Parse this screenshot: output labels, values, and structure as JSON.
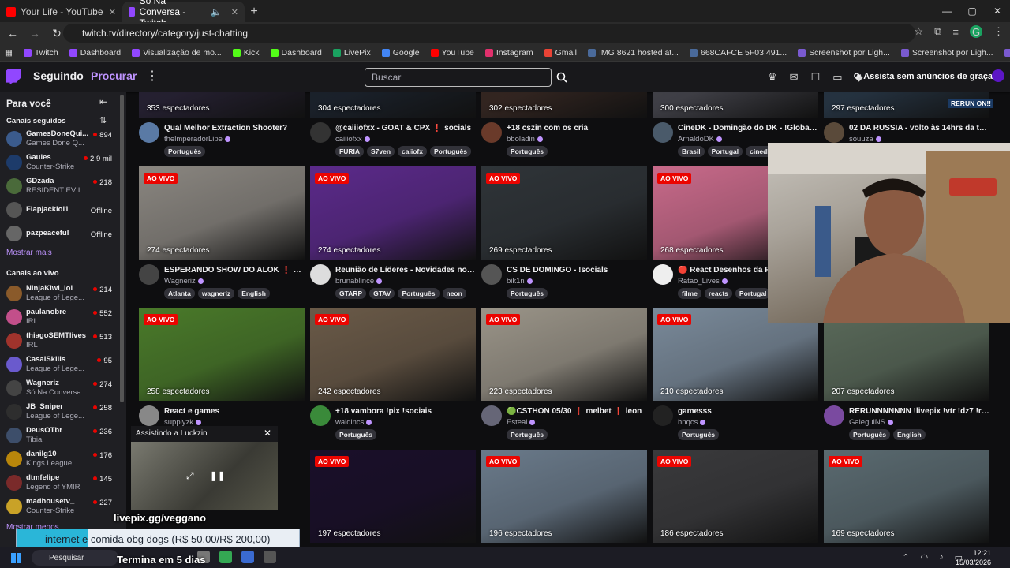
{
  "browser": {
    "tabs": [
      {
        "title": "Your Life - YouTube",
        "active": false,
        "color": "#ff0000"
      },
      {
        "title": "Só Na Conversa - Twitch",
        "active": true,
        "color": "#9147ff"
      }
    ],
    "url": "twitch.tv/directory/category/just-chatting",
    "bookmarks": [
      "Twitch",
      "Dashboard",
      "Visualização de mo...",
      "Kick",
      "Dashboard",
      "LivePix",
      "Google",
      "YouTube",
      "Instagram",
      "Gmail",
      "IMG 8621 hosted at...",
      "668CAFCE 5F03 491...",
      "Screenshot por Ligh...",
      "Screenshot por Ligh...",
      "Screenshot por Ligh..."
    ],
    "profile_initial": "G"
  },
  "nav": {
    "following": "Seguindo",
    "browse": "Procurar",
    "search_placeholder": "Buscar",
    "no_ads": "Assista sem anúncios de graça"
  },
  "sidebar": {
    "title": "Para você",
    "followed_heading": "Canais seguidos",
    "followed": [
      {
        "name": "GamesDoneQui...",
        "game": "Games Done Q...",
        "viewers": "894",
        "color": "#3b5b8c"
      },
      {
        "name": "Gaules",
        "game": "Counter-Strike",
        "viewers": "2,9 mil",
        "color": "#1d3b6a"
      },
      {
        "name": "GDzada",
        "game": "RESIDENT EVIL...",
        "viewers": "218",
        "color": "#4a6a3a"
      },
      {
        "name": "Flapjacklol1",
        "game": "",
        "viewers": "Offline",
        "color": "#555"
      },
      {
        "name": "pazpeaceful",
        "game": "",
        "viewers": "Offline",
        "color": "#666"
      }
    ],
    "show_more": "Mostrar mais",
    "live_heading": "Canais ao vivo",
    "live": [
      {
        "name": "NinjaKiwi_lol",
        "game": "League of Lege...",
        "viewers": "214",
        "color": "#8a5a2a"
      },
      {
        "name": "paulanobre",
        "game": "IRL",
        "viewers": "552",
        "color": "#c24f8a"
      },
      {
        "name": "thiagoSEMTlives",
        "game": "IRL",
        "viewers": "513",
        "color": "#a0332c"
      },
      {
        "name": "CasalSkills",
        "game": "League of Lege...",
        "viewers": "95",
        "color": "#6a5acd"
      },
      {
        "name": "Wagneriz",
        "game": "Só Na Conversa",
        "viewers": "274",
        "color": "#444"
      },
      {
        "name": "JB_Sniper",
        "game": "League of Lege...",
        "viewers": "258",
        "color": "#2e2e2e"
      },
      {
        "name": "DeusOTbr",
        "game": "Tibia",
        "viewers": "236",
        "color": "#3d4e6a"
      },
      {
        "name": "danilg10",
        "game": "Kings League",
        "viewers": "176",
        "color": "#b8860b"
      },
      {
        "name": "dtmfelipe",
        "game": "Legend of YMIR",
        "viewers": "145",
        "color": "#7a2a2a"
      },
      {
        "name": "madhousetv_",
        "game": "Counter-Strike",
        "viewers": "227",
        "color": "#c9a227"
      }
    ],
    "show_more_2": "Mostrar menos"
  },
  "live_label": "AO VIVO",
  "cards": [
    {
      "viewers": "353 espectadores",
      "title": "Qual Melhor Extraction Shooter?",
      "channel": "thelmperadorLipe",
      "tags": [
        "Português"
      ],
      "live": false,
      "thumb": "#2a2438",
      "avatar": "#5a7aa5"
    },
    {
      "viewers": "304 espectadores",
      "title": "@caiiiofxx - GOAT & CPX ❗ socials",
      "channel": "caiiiofxx",
      "tags": [
        "FURIA",
        "S7ven",
        "caiiofx",
        "Português"
      ],
      "live": false,
      "thumb": "#1d2530",
      "avatar": "#333"
    },
    {
      "viewers": "302 espectadores",
      "title": "+18 cszin com os cria",
      "channel": "bboladin",
      "tags": [
        "Português"
      ],
      "live": false,
      "thumb": "#3a2a24",
      "avatar": "#6a3a2a"
    },
    {
      "viewers": "300 espectadores",
      "title": "CineDK - Domingão do DK - !Global !...",
      "channel": "ArnaldoDK",
      "tags": [
        "Brasil",
        "Portugal",
        "cinedk"
      ],
      "live": false,
      "thumb": "#4a4a52",
      "avatar": "#4a5a6a"
    },
    {
      "viewers": "297 espectadores",
      "title": "02 DA RUSSIA - volto às 14hrs da tard...",
      "channel": "souuza",
      "tags": [],
      "live": false,
      "thumb": "#2a3a4a",
      "avatar": "#5a4a3a"
    },
    {
      "viewers": "274 espectadores",
      "title": "ESPERANDO SHOW DO ALOK ❗ pixgg...",
      "channel": "Wagneriz",
      "tags": [
        "Atlanta",
        "wagneriz",
        "English"
      ],
      "live": true,
      "thumb": "#8a8680",
      "avatar": "#444"
    },
    {
      "viewers": "274 espectadores",
      "title": "Reunião de Líderes - Novidades no IL...",
      "channel": "brunablince",
      "tags": [
        "GTARP",
        "GTAV",
        "Português",
        "neon"
      ],
      "live": true,
      "thumb": "#5b2a8a",
      "avatar": "#ddd"
    },
    {
      "viewers": "269 espectadores",
      "title": "CS DE DOMINGO - !socials",
      "channel": "bik1n",
      "tags": [
        "Português"
      ],
      "live": true,
      "thumb": "#2f3438",
      "avatar": "#555"
    },
    {
      "viewers": "268 espectadores",
      "title": "🔴 React Desenhos da Pe...",
      "channel": "Ratao_Lives",
      "tags": [
        "filme",
        "reacts",
        "Portugal"
      ],
      "live": true,
      "thumb": "#c86a8a",
      "avatar": "#eee"
    },
    {
      "viewers": "",
      "title": "",
      "channel": "",
      "tags": [],
      "live": false,
      "thumb": "#000",
      "avatar": "#000"
    },
    {
      "viewers": "258 espectadores",
      "title": "React e games",
      "channel": "supplyzk",
      "tags": [],
      "live": true,
      "thumb": "#4a7a2a",
      "avatar": "#888"
    },
    {
      "viewers": "242 espectadores",
      "title": "+18 vambora !pix !sociais",
      "channel": "waldincs",
      "tags": [
        "Português"
      ],
      "live": true,
      "thumb": "#6a5a48",
      "avatar": "#3a8a3a"
    },
    {
      "viewers": "223 espectadores",
      "title": "🟢CSTHON 05/30 ❗ melbet ❗ leon",
      "channel": "Esteal",
      "tags": [
        "Português"
      ],
      "live": true,
      "thumb": "#9a9488",
      "avatar": "#667"
    },
    {
      "viewers": "210 espectadores",
      "title": "gamesss",
      "channel": "hnqcs",
      "tags": [
        "Português"
      ],
      "live": true,
      "thumb": "#7a8a9a",
      "avatar": "#222"
    },
    {
      "viewers": "207 espectadores",
      "title": "RERUNNNNNNN !livepix !vtr !dz7 !re...",
      "channel": "GaleguiNS",
      "tags": [
        "Português",
        "English"
      ],
      "live": false,
      "thumb": "#5a6a5a",
      "avatar": "#7a4aa0"
    },
    {
      "viewers": "",
      "title": "",
      "channel": "",
      "tags": [],
      "live": false,
      "thumb": "#222",
      "avatar": "#222"
    },
    {
      "viewers": "197 espectadores",
      "title": "",
      "channel": "",
      "tags": [],
      "live": true,
      "thumb": "#1a0f2a",
      "avatar": "#000"
    },
    {
      "viewers": "196 espectadores",
      "title": "",
      "channel": "",
      "tags": [],
      "live": true,
      "thumb": "#6a7a8a",
      "avatar": "#000"
    },
    {
      "viewers": "186 espectadores",
      "title": "",
      "channel": "",
      "tags": [],
      "live": true,
      "thumb": "#3a3a3c",
      "avatar": "#000"
    },
    {
      "viewers": "169 espectadores",
      "title": "",
      "channel": "",
      "tags": [],
      "live": true,
      "thumb": "#5a6a70",
      "avatar": "#000"
    }
  ],
  "rerun_badge": "RERUN ON!!",
  "mini_player": {
    "title": "Assistindo a Luckzin"
  },
  "overlay": {
    "url": "livepix.gg/veggano",
    "donation": "internet e comida obg dogs (R$ 50,00/R$ 200,00)",
    "donation_progress": 0.25,
    "timer": "Termina em 5 dias"
  },
  "taskbar": {
    "search": "Pesquisar",
    "time": "12:21",
    "date": "15/03/2026"
  }
}
